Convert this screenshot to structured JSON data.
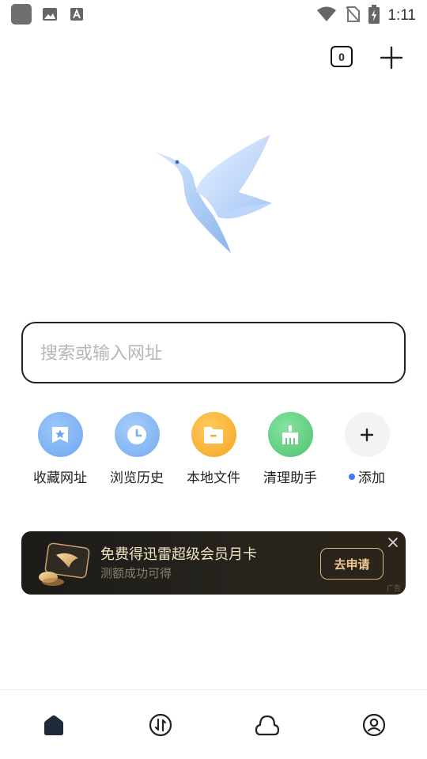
{
  "status_bar": {
    "time": "1:11",
    "icons": [
      "app-icon",
      "image-icon",
      "font-icon",
      "wifi-icon",
      "no-sim-icon",
      "battery-charging-icon"
    ]
  },
  "top_bar": {
    "tab_count": "0",
    "new_tab_icon": "plus-icon"
  },
  "logo": {
    "icon": "hummingbird-logo"
  },
  "search": {
    "placeholder": "搜索或输入网址",
    "value": ""
  },
  "quick_links": [
    {
      "label": "收藏网址",
      "icon": "bookmark-star-icon",
      "color": "#7fb3f5"
    },
    {
      "label": "浏览历史",
      "icon": "clock-icon",
      "color": "#82b8f3"
    },
    {
      "label": "本地文件",
      "icon": "folder-icon",
      "color": "#f7b544"
    },
    {
      "label": "清理助手",
      "icon": "broom-icon",
      "color": "#6dd18c"
    },
    {
      "label": "添加",
      "icon": "plus-icon",
      "color": "#f3f3f3",
      "has_dot": true
    }
  ],
  "banner": {
    "title": "免费得迅雷超级会员月卡",
    "subtitle": "测额成功可得",
    "button": "去申请",
    "ad_tag": "广告",
    "close_icon": "close-icon"
  },
  "bottom_nav": [
    {
      "name": "home",
      "icon": "home-icon",
      "active": true
    },
    {
      "name": "transfer",
      "icon": "transfer-icon"
    },
    {
      "name": "cloud",
      "icon": "cloud-icon"
    },
    {
      "name": "profile",
      "icon": "profile-icon"
    }
  ],
  "colors": {
    "accent": "#3b7cff",
    "banner_gold": "#e0b57a",
    "placeholder": "#b6b6b6"
  }
}
